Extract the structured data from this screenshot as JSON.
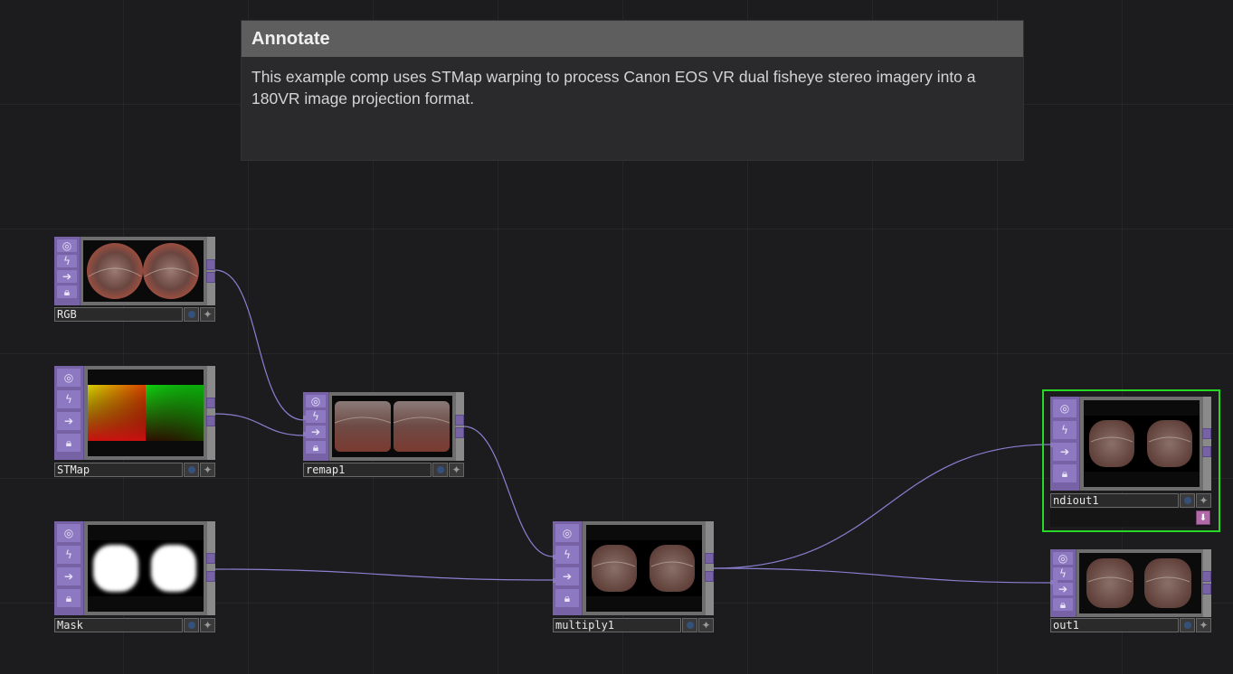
{
  "annotation": {
    "title": "Annotate",
    "body": "This example comp uses STMap warping to process Canon EOS VR dual fisheye stereo imagery into a 180VR image projection format."
  },
  "nodes": {
    "rgb": {
      "name": "RGB",
      "thumbnail": "dual fisheye source image"
    },
    "stmap": {
      "name": "STMap",
      "thumbnail": "red-green UV gradient map"
    },
    "mask": {
      "name": "Mask",
      "thumbnail": "two white rounded squares on black"
    },
    "remap1": {
      "name": "remap1",
      "thumbnail": "remapped panorama"
    },
    "multiply1": {
      "name": "multiply1",
      "thumbnail": "masked dual image"
    },
    "ndiout1": {
      "name": "ndiout1",
      "thumbnail": "masked dual image",
      "selected": true
    },
    "out1": {
      "name": "out1",
      "thumbnail": "masked dual image"
    }
  },
  "icons": {
    "viewer_buttons": [
      "target-icon",
      "bolt-icon",
      "arrow-right-icon",
      "lock-icon"
    ],
    "flag_buttons": [
      "blue-dot-icon",
      "plus-icon"
    ],
    "ndi_button": "down-arrow-icon"
  },
  "colors": {
    "background": "#1c1c1f",
    "wire": "#8a7fd0",
    "viewer_strip": "#7762a6",
    "selection": "#27d827",
    "ndi_button": "#b06aa8"
  }
}
